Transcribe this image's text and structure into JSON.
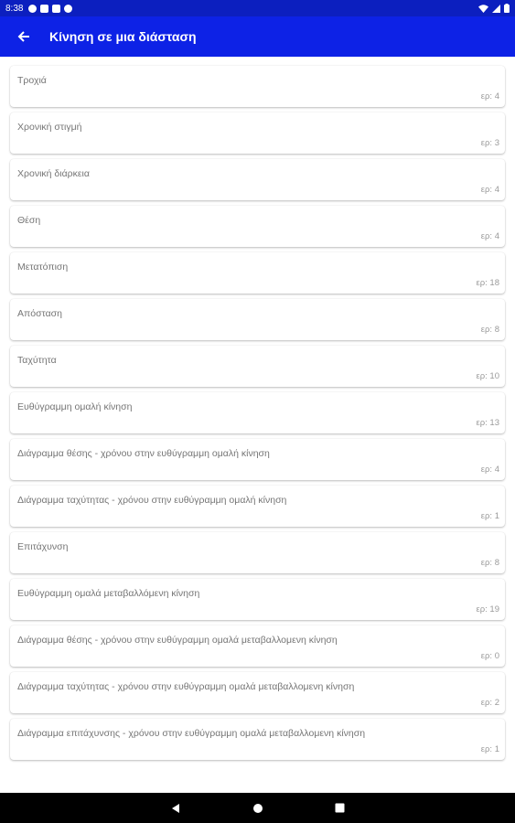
{
  "status_bar": {
    "time": "8:38",
    "icons": [
      "notification-icon",
      "notification-icon",
      "notification-icon",
      "notification-icon",
      "wifi-icon",
      "signal-icon",
      "battery-icon"
    ]
  },
  "app_bar": {
    "title": "Κίνηση σε μια διάσταση",
    "back_icon": "arrow-back-icon",
    "color": "#0d22e6"
  },
  "topics": [
    {
      "label": "Τροχιά",
      "count": "ερ: 4"
    },
    {
      "label": "Χρονική στιγμή",
      "count": "ερ: 3"
    },
    {
      "label": "Χρονική διάρκεια",
      "count": "ερ: 4"
    },
    {
      "label": "Θέση",
      "count": "ερ: 4"
    },
    {
      "label": "Μετατόπιση",
      "count": "ερ: 18"
    },
    {
      "label": "Απόσταση",
      "count": "ερ: 8"
    },
    {
      "label": "Ταχύτητα",
      "count": "ερ: 10"
    },
    {
      "label": "Ευθύγραμμη ομαλή κίνηση",
      "count": "ερ: 13"
    },
    {
      "label": "Διάγραμμα θέσης - χρόνου στην ευθύγραμμη ομαλή κίνηση",
      "count": "ερ: 4"
    },
    {
      "label": "Διάγραμμα ταχύτητας - χρόνου στην ευθύγραμμη ομαλή κίνηση",
      "count": "ερ: 1"
    },
    {
      "label": "Επιτάχυνση",
      "count": "ερ: 8"
    },
    {
      "label": "Ευθύγραμμη ομαλά μεταβαλλόμενη κίνηση",
      "count": "ερ: 19"
    },
    {
      "label": "Διάγραμμα θέσης - χρόνου στην ευθύγραμμη ομαλά μεταβαλλομενη κίνηση",
      "count": "ερ: 0"
    },
    {
      "label": "Διάγραμμα ταχύτητας - χρόνου στην ευθύγραμμη ομαλά μεταβαλλομενη κίνηση",
      "count": "ερ: 2"
    },
    {
      "label": "Διάγραμμα επιτάχυνσης - χρόνου στην ευθύγραμμη ομαλά μεταβαλλομενη κίνηση",
      "count": "ερ: 1"
    }
  ],
  "nav_bar": {
    "icons": [
      "nav-back-icon",
      "nav-home-icon",
      "nav-recents-icon"
    ]
  }
}
